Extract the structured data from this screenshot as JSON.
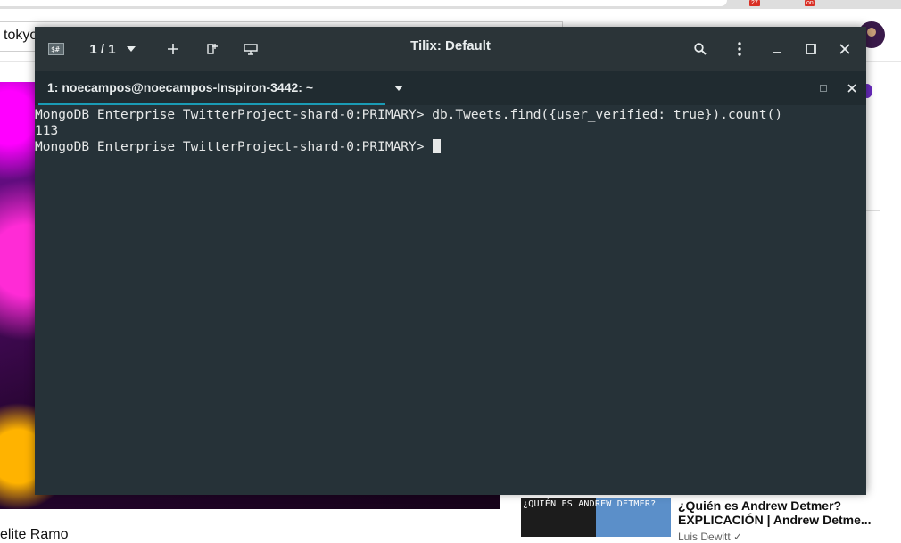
{
  "background_browser": {
    "badges": [
      "27",
      "on"
    ],
    "search_text": "tokyo",
    "thumbnail_text": "¿QUIÉN ES ANDREW DETMER?",
    "video_title": "¿Quién es Andrew Detmer? EXPLICACIÓN | Andrew Detme...",
    "channel": "Luis Dewitt ✓",
    "partial_title": "elite Ramo"
  },
  "tilix": {
    "window_title": "Tilix: Default",
    "session_counter": "1 / 1",
    "tab_title": "1: noecampos@noecampos-Inspiron-3442: ~",
    "accent_color": "#1a9bb5",
    "icons": [
      "session-switcher-icon",
      "dropdown-icon",
      "add-icon",
      "new-window-icon",
      "sync-input-icon",
      "search-icon",
      "menu-icon",
      "minimize-icon",
      "maximize-icon",
      "close-icon",
      "tab-dropdown-icon",
      "tab-maximize-icon",
      "tab-close-icon"
    ]
  },
  "terminal": {
    "lines": [
      "MongoDB Enterprise TwitterProject-shard-0:PRIMARY> db.Tweets.find({user_verified: true}).count()",
      "113"
    ],
    "prompt": "MongoDB Enterprise TwitterProject-shard-0:PRIMARY> "
  }
}
